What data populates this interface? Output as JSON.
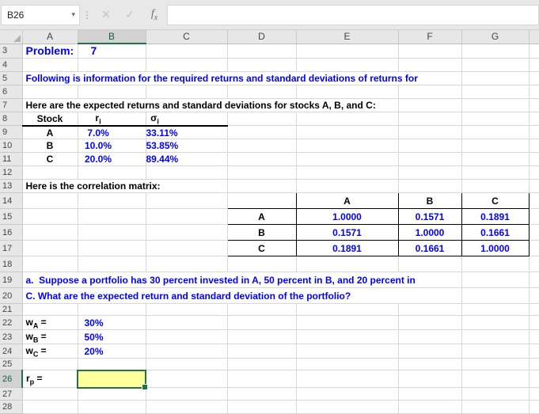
{
  "formula_bar": {
    "name_box": "B26",
    "caret_icon": "▾",
    "grip_icon": "⋮",
    "cancel_icon": "✕",
    "confirm_icon": "✓",
    "fx_base": "f",
    "fx_sub": "x",
    "formula_value": ""
  },
  "grid": {
    "column_letters": [
      "A",
      "B",
      "C",
      "D",
      "E",
      "F",
      "G"
    ],
    "row_numbers": [
      "3",
      "4",
      "5",
      "6",
      "7",
      "8",
      "9",
      "10",
      "11",
      "12",
      "13",
      "14",
      "15",
      "16",
      "17",
      "18",
      "19",
      "20",
      "21",
      "22",
      "23",
      "24",
      "25",
      "26",
      "27",
      "28"
    ]
  },
  "selection": {
    "cell": "B26",
    "fill_color": "#FFFF9C",
    "border_color": "#217346"
  },
  "colors": {
    "input_text_blue": "#0000FF",
    "label_text_black": "#000000",
    "header_gray": "#E7E7E7",
    "selected_header_gray": "#D2D2D2",
    "excel_green": "#217346"
  },
  "content": {
    "problem_label": "Problem:",
    "problem_number": "7",
    "line5": "Following is information for the required returns and standard deviations of returns for",
    "line7": "Here are the expected returns and standard deviations for stocks A, B, and C:",
    "stock_table": {
      "header": {
        "stock": "Stock",
        "r_base": "r",
        "r_sub": "i",
        "sigma_base": "σ",
        "sigma_sub": "i"
      },
      "rows": [
        {
          "stock": "A",
          "r": "7.0%",
          "sigma": "33.11%"
        },
        {
          "stock": "B",
          "r": "10.0%",
          "sigma": "53.85%"
        },
        {
          "stock": "C",
          "r": "20.0%",
          "sigma": "89.44%"
        }
      ]
    },
    "line13": "Here is the correlation matrix:",
    "correlation_matrix": {
      "col_headers": [
        "A",
        "B",
        "C"
      ],
      "rows": [
        {
          "label": "A",
          "values": [
            "1.0000",
            "0.1571",
            "0.1891"
          ]
        },
        {
          "label": "B",
          "values": [
            "0.1571",
            "1.0000",
            "0.1661"
          ]
        },
        {
          "label": "C",
          "values": [
            "0.1891",
            "0.1661",
            "1.0000"
          ]
        }
      ]
    },
    "line19": "a.  Suppose a portfolio has 30 percent invested in A, 50 percent in B, and 20 percent in",
    "line20": "C. What are the expected return and standard deviation of the portfolio?",
    "weights": [
      {
        "base": "w",
        "sub": "A",
        "eq": " =",
        "value": "30%"
      },
      {
        "base": "w",
        "sub": "B",
        "eq": " =",
        "value": "50%"
      },
      {
        "base": "w",
        "sub": "C",
        "eq": " =",
        "value": "20%"
      }
    ],
    "rp_label": {
      "base": "r",
      "sub": "p",
      "eq": " ="
    }
  }
}
